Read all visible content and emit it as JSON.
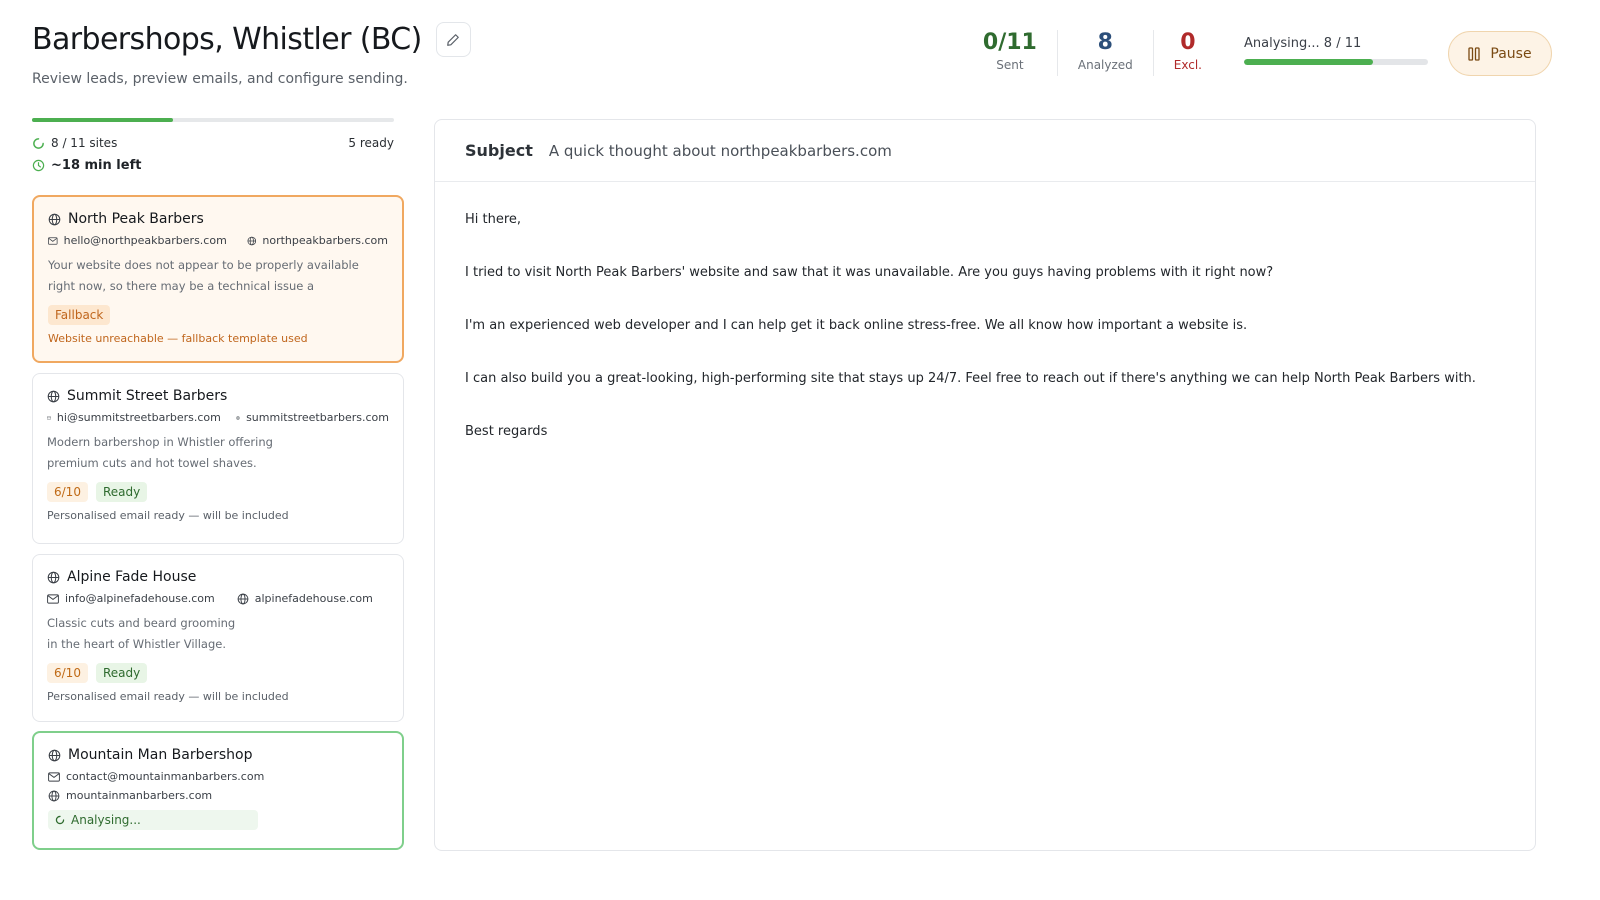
{
  "header": {
    "title": "Barbershops, Whistler (BC)",
    "subtitle": "Review leads, preview emails, and configure sending."
  },
  "stats": {
    "sent_value": "0/11",
    "sent_label": "Sent",
    "analyzed_value": "8",
    "analyzed_label": "Analyzed",
    "excluded_value": "0",
    "excluded_label": "Excl.",
    "analysing_text": "Analysing... 8 / 11",
    "analysing_progress": 0.7,
    "pause_label": "Pause"
  },
  "progress": {
    "overall_fraction": 0.39,
    "sites_text": "8 / 11 sites",
    "ready_text": "5 ready",
    "time_left": "~18 min left"
  },
  "leads": [
    {
      "name": "North Peak Barbers",
      "email": "hello@northpeakbarbers.com",
      "site": "northpeakbarbers.com",
      "desc_line1": "Your website does not appear to be properly available",
      "desc_line2": "right now, so there may be a technical issue a",
      "badge": "Fallback",
      "note": "Website unreachable — fallback template used"
    },
    {
      "name": "Summit Street Barbers",
      "email": "hi@summitstreetbarbers.com",
      "site": "summitstreetbarbers.com",
      "desc_line1": "Modern barbershop in Whistler offering",
      "desc_line2": "premium cuts and hot towel shaves.",
      "score": "6/10",
      "status": "Ready",
      "note": "Personalised email ready — will be included"
    },
    {
      "name": "Alpine Fade House",
      "email": "info@alpinefadehouse.com",
      "site": "alpinefadehouse.com",
      "desc_line1": "Classic cuts and beard grooming",
      "desc_line2": "in the heart of Whistler Village.",
      "score": "6/10",
      "status": "Ready",
      "note": "Personalised email ready — will be included"
    },
    {
      "name": "Mountain Man Barbershop",
      "email": "contact@mountainmanbarbers.com",
      "site": "mountainmanbarbers.com",
      "status": "Analysing..."
    }
  ],
  "email": {
    "subject_label": "Subject",
    "subject": "A quick thought about northpeakbarbers.com",
    "greeting": "Hi there,",
    "p1": "I tried to visit North Peak Barbers' website and saw that it was unavailable. Are you guys having problems with it right now?",
    "p2": "I'm an experienced web developer and I can help get it back online stress-free. We all know how important a website is.",
    "p3": "I can also build you a great-looking, high-performing site that stays up 24/7. Feel free to reach out if there's anything we can help North Peak Barbers with.",
    "signoff": "Best regards"
  },
  "colors": {
    "accent_green": "#4caf50",
    "fallback_orange": "#c0661d",
    "excluded_red": "#b02a2a"
  }
}
